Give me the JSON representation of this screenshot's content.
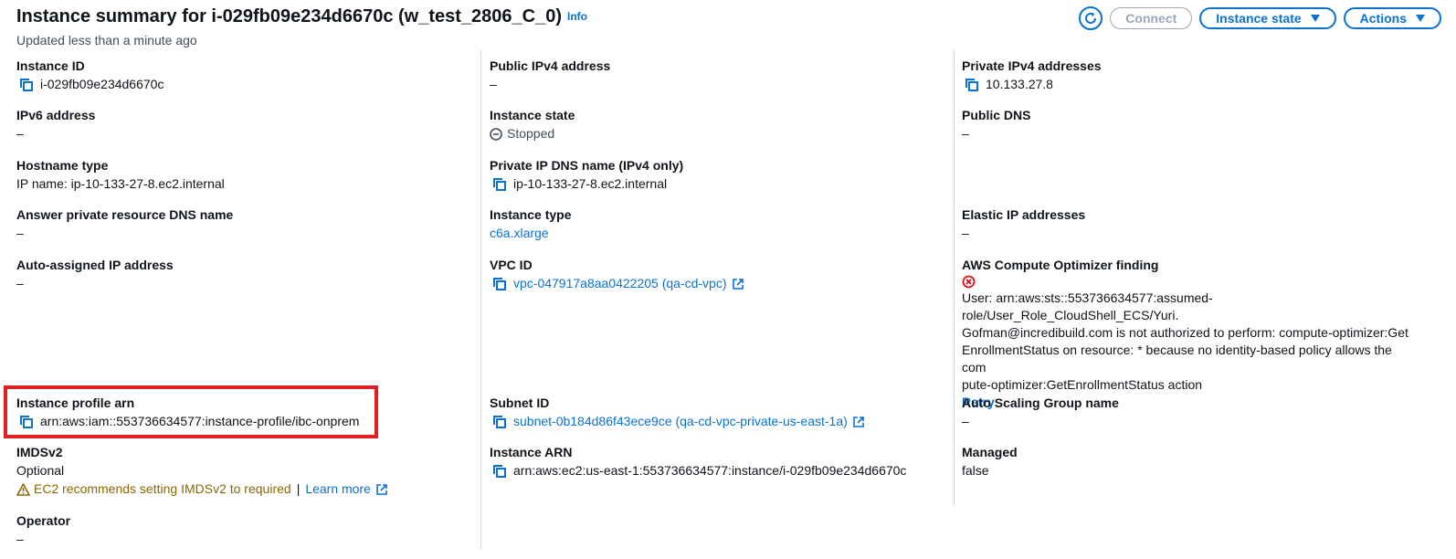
{
  "header": {
    "title": "Instance summary for i-029fb09e234d6670c (w_test_2806_C_0)",
    "info": "Info",
    "subtitle": "Updated less than a minute ago",
    "connect_label": "Connect",
    "instance_state_label": "Instance state",
    "actions_label": "Actions"
  },
  "col1": {
    "instance_id": {
      "label": "Instance ID",
      "value": "i-029fb09e234d6670c"
    },
    "ipv6": {
      "label": "IPv6 address",
      "value": "–"
    },
    "hostname_type": {
      "label": "Hostname type",
      "value": "IP name: ip-10-133-27-8.ec2.internal"
    },
    "answer_dns": {
      "label": "Answer private resource DNS name",
      "value": "–"
    },
    "auto_ip": {
      "label": "Auto-assigned IP address",
      "value": "–"
    },
    "profile_arn": {
      "label": "Instance profile arn",
      "value": "arn:aws:iam::553736634577:instance-profile/ibc-onprem"
    },
    "imdsv2": {
      "label": "IMDSv2",
      "value": "Optional",
      "warning": "EC2 recommends setting IMDSv2 to required",
      "sep": "|",
      "learn_more": "Learn more"
    },
    "operator": {
      "label": "Operator",
      "value": "–"
    }
  },
  "col2": {
    "public_ipv4": {
      "label": "Public IPv4 address",
      "value": "–"
    },
    "instance_state": {
      "label": "Instance state",
      "value": "Stopped"
    },
    "private_dns": {
      "label": "Private IP DNS name (IPv4 only)",
      "value": "ip-10-133-27-8.ec2.internal"
    },
    "instance_type": {
      "label": "Instance type",
      "value": "c6a.xlarge"
    },
    "vpc_id": {
      "label": "VPC ID",
      "value": "vpc-047917a8aa0422205 (qa-cd-vpc)"
    },
    "subnet_id": {
      "label": "Subnet ID",
      "value": "subnet-0b184d86f43ece9ce (qa-cd-vpc-private-us-east-1a)"
    },
    "instance_arn": {
      "label": "Instance ARN",
      "value": "arn:aws:ec2:us-east-1:553736634577:instance/i-029fb09e234d6670c"
    }
  },
  "col3": {
    "private_ipv4": {
      "label": "Private IPv4 addresses",
      "value": "10.133.27.8"
    },
    "public_dns": {
      "label": "Public DNS",
      "value": "–"
    },
    "elastic_ip": {
      "label": "Elastic IP addresses",
      "value": "–"
    },
    "optimizer": {
      "label": "AWS Compute Optimizer finding",
      "lines": [
        "User: arn:aws:sts::553736634577:assumed-role/User_Role_CloudShell_ECS/Yuri.",
        "Gofman@incredibuild.com is not authorized to perform: compute-optimizer:Get",
        "EnrollmentStatus on resource: * because no identity-based policy allows the com",
        "pute-optimizer:GetEnrollmentStatus action"
      ],
      "retry": "Retry"
    },
    "asg": {
      "label": "Auto Scaling Group name",
      "value": "–"
    },
    "managed": {
      "label": "Managed",
      "value": "false"
    }
  },
  "colors": {
    "link": "#0972d3",
    "highlight": "#e02020",
    "error": "#d91515",
    "warning": "#8d6605"
  }
}
